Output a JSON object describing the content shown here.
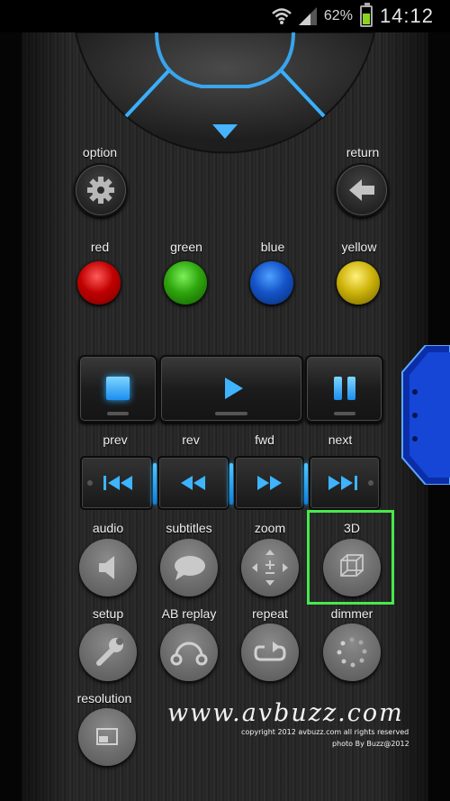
{
  "status_bar": {
    "battery_percent": "62%",
    "time": "14:12",
    "battery_color": "#8cd322",
    "icons": [
      "wifi-icon",
      "signal-icon",
      "battery-icon"
    ]
  },
  "nav_pad": {
    "down_arrow_icon": "triangle-down-icon"
  },
  "option": {
    "label": "option",
    "icon": "gear-icon"
  },
  "return": {
    "label": "return",
    "icon": "arrow-left-icon"
  },
  "color_buttons": [
    {
      "label": "red",
      "color": "#c00000"
    },
    {
      "label": "green",
      "color": "#2ea50c"
    },
    {
      "label": "blue",
      "color": "#1454c9"
    },
    {
      "label": "yellow",
      "color": "#cdb30a"
    }
  ],
  "transport": {
    "icons": [
      "stop-icon",
      "play-icon",
      "pause-icon"
    ]
  },
  "skip": {
    "labels": {
      "prev": "prev",
      "rev": "rev",
      "fwd": "fwd",
      "next": "next"
    },
    "icons": [
      "skip-prev-icon",
      "rewind-icon",
      "fast-forward-icon",
      "skip-next-icon"
    ]
  },
  "functions": [
    {
      "label": "audio",
      "icon": "speaker-icon"
    },
    {
      "label": "subtitles",
      "icon": "speech-bubble-icon"
    },
    {
      "label": "zoom",
      "icon": "zoom-pad-icon"
    },
    {
      "label": "3D",
      "icon": "cube-icon",
      "highlighted": true
    },
    {
      "label": "setup",
      "icon": "wrench-icon"
    },
    {
      "label": "AB replay",
      "icon": "ab-loop-icon"
    },
    {
      "label": "repeat",
      "icon": "repeat-icon"
    },
    {
      "label": "dimmer",
      "icon": "dimmer-icon"
    },
    {
      "label": "resolution",
      "icon": "resolution-icon"
    }
  ],
  "highlight_color": "#48e84c",
  "watermark": {
    "site": "www.avbuzz.com",
    "copyright": "copyright 2012 avbuzz.com all rights reserved",
    "photo": "photo By Buzz@2012"
  }
}
